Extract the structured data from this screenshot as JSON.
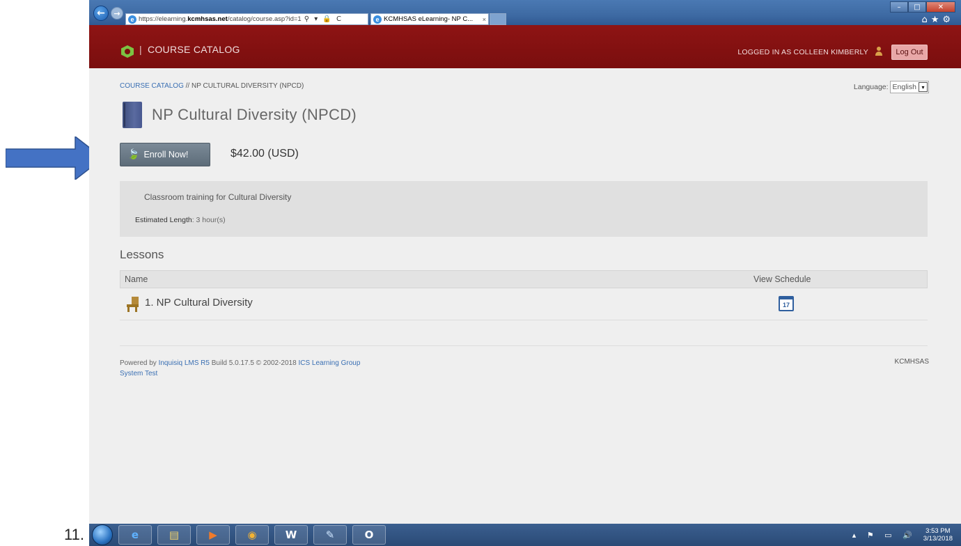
{
  "slide": {
    "number_label": "11."
  },
  "browser": {
    "url_host_prefix": "https://elearning.",
    "url_host": "kcmhsas.net",
    "url_path": "/catalog/course.asp?id=1",
    "url_tools": "⚲ ▾ 🔒 C",
    "tab_title": "KCMHSAS eLearning- NP C...",
    "tab_close": "×",
    "back_icon": "←",
    "forward_icon": "→",
    "min_label": "–",
    "max_label": "□",
    "close_label": "✕",
    "browser_icons": "⌂★⚙"
  },
  "header": {
    "separator": "|",
    "title": "COURSE CATALOG",
    "logged_in_text": "LOGGED IN AS COLLEEN KIMBERLY",
    "logout_label": "Log Out",
    "brand_color": "#7a0e0e"
  },
  "breadcrumb": {
    "link": "COURSE CATALOG",
    "rest": " // NP CULTURAL DIVERSITY (NPCD)"
  },
  "language": {
    "label": "Language:",
    "selected": "English",
    "dropdown_icon": "▾"
  },
  "course": {
    "title": "NP Cultural Diversity (NPCD)",
    "enroll_icon": "🍃",
    "enroll_label": "Enroll Now!",
    "price": "$42.00 (USD)",
    "description": "Classroom training for Cultural Diversity",
    "est_label": "Estimated Length",
    "est_value": ": 3 hour(s)"
  },
  "lessons": {
    "title": "Lessons",
    "col_name": "Name",
    "col_schedule": "View Schedule",
    "items": [
      {
        "name": "1. NP Cultural Diversity",
        "calendar_day": "17"
      }
    ]
  },
  "footer": {
    "powered_prefix": "Powered by ",
    "product_link": "Inquisiq LMS R5",
    "build_text": " Build 5.0.17.5 © 2002-2018 ",
    "company_link": "ICS Learning Group",
    "system_link": "System Test",
    "right_text": "KCMHSAS"
  },
  "taskbar": {
    "items": [
      {
        "name": "ie",
        "glyph": "e",
        "color": "#5fb2ff"
      },
      {
        "name": "explorer",
        "glyph": "▤",
        "color": "#f2d26b"
      },
      {
        "name": "media",
        "glyph": "▶",
        "color": "#f07b2a"
      },
      {
        "name": "chrome",
        "glyph": "◉",
        "color": "#f2b233"
      },
      {
        "name": "word",
        "glyph": "W",
        "color": "#ffffff"
      },
      {
        "name": "paint",
        "glyph": "✎",
        "color": "#cfe6ff"
      },
      {
        "name": "outlook",
        "glyph": "O",
        "color": "#ffffff"
      }
    ],
    "tray_icons": "▴ ⚑ ▭ 🔊",
    "time": "3:53 PM",
    "date": "3/13/2018"
  }
}
